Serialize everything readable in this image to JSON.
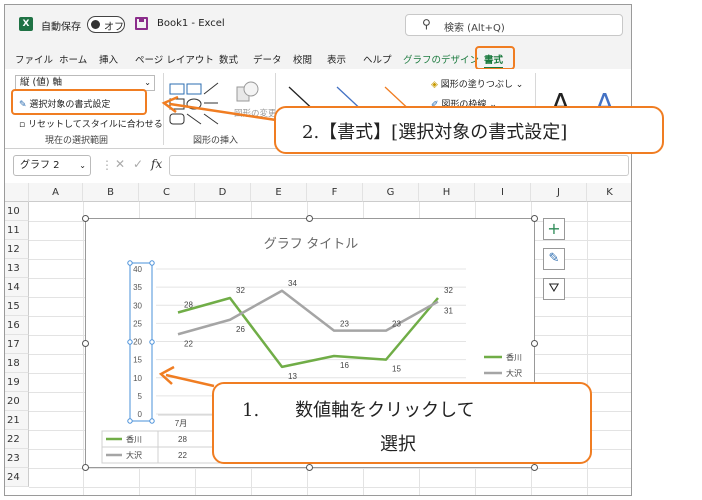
{
  "titlebar": {
    "app_icon": "X",
    "autosave_label": "自動保存",
    "toggle_label": "オフ",
    "doc_title": "Book1  -  Excel",
    "search_placeholder": "検索 (Alt+Q)"
  },
  "tabs": [
    "ファイル",
    "ホーム",
    "挿入",
    "ページ レイアウト",
    "数式",
    "データ",
    "校閲",
    "表示",
    "ヘルプ",
    "グラフのデザイン",
    "書式"
  ],
  "ribbon": {
    "element_dropdown": "縦 (値) 軸",
    "format_selection": "選択対象の書式設定",
    "reset_style": "リセットしてスタイルに合わせる",
    "group_current_selection": "現在の選択範囲",
    "shape_change": "図形の変更",
    "group_insert_shapes": "図形の挿入",
    "shape_fill": "図形の塗りつぶし",
    "shape_outline": "図形の枠線",
    "wordart_letter": "A"
  },
  "formula_bar": {
    "name_box": "グラフ 2",
    "fx": "fx",
    "cancel": "✕",
    "enter": "✓"
  },
  "grid": {
    "columns": [
      "A",
      "B",
      "C",
      "D",
      "E",
      "F",
      "G",
      "H",
      "I",
      "J",
      "K"
    ],
    "rows": [
      "10",
      "11",
      "12",
      "13",
      "14",
      "15",
      "16",
      "17",
      "18",
      "19",
      "20",
      "21",
      "22",
      "23",
      "24"
    ]
  },
  "chart_data": {
    "type": "line",
    "title": "グラフ タイトル",
    "categories": [
      "7月",
      "",
      "",
      "",
      "",
      ""
    ],
    "series": [
      {
        "name": "香川",
        "values": [
          28,
          32,
          13,
          16,
          15,
          32
        ],
        "color": "#70ad47"
      },
      {
        "name": "大沢",
        "values": [
          22,
          26,
          34,
          23,
          23,
          31
        ],
        "color": "#a5a5a5"
      }
    ],
    "y_ticks": [
      "40",
      "35",
      "30",
      "25",
      "20",
      "15",
      "10",
      "5",
      "0"
    ],
    "ylim": [
      0,
      40
    ],
    "data_table": {
      "header": "7月",
      "rows": [
        {
          "name": "香川",
          "value": "28"
        },
        {
          "name": "大沢",
          "value": "22"
        }
      ]
    },
    "legend_position": "right"
  },
  "chart_tools": {
    "add_element": "+"
  },
  "callouts": {
    "step2": "2.【書式】[選択対象の書式設定]",
    "step1_line1": "1.　　数値軸をクリックして",
    "step1_line2": "選択"
  },
  "colors": {
    "accent_orange": "#f07d22",
    "excel_green": "#1f7244",
    "series_kagawa": "#70ad47",
    "series_osawa": "#a5a5a5"
  }
}
